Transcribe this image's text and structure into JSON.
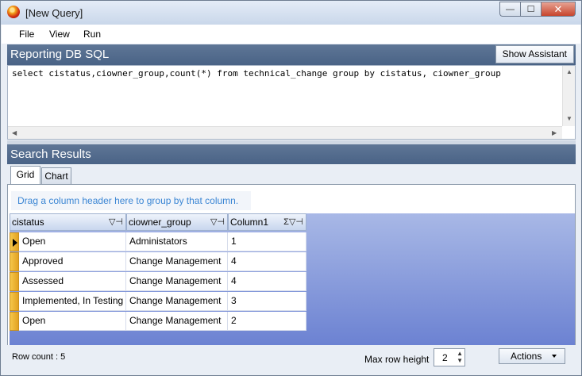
{
  "window": {
    "title": "[New Query]",
    "controls": {
      "minimize": "—",
      "maximize": "☐",
      "close": "✕"
    }
  },
  "menu": {
    "items": [
      {
        "label": "File"
      },
      {
        "label": "View"
      },
      {
        "label": "Run"
      }
    ]
  },
  "sql_panel": {
    "title": "Reporting DB SQL",
    "assistant_button": "Show Assistant",
    "query": "select cistatus,ciowner_group,count(*) from technical_change group by cistatus, ciowner_group"
  },
  "results": {
    "title": "Search Results",
    "tabs": [
      {
        "label": "Grid",
        "active": true
      },
      {
        "label": "Chart",
        "active": false
      }
    ],
    "group_hint": "Drag a column header here to group by that column.",
    "columns": [
      {
        "label": "cistatus"
      },
      {
        "label": "ciowner_group"
      },
      {
        "label": "Column1"
      }
    ],
    "rows": [
      {
        "cistatus": "Open",
        "ciowner_group": "Administators",
        "column1": "1"
      },
      {
        "cistatus": "Approved",
        "ciowner_group": "Change Management",
        "column1": "4"
      },
      {
        "cistatus": "Assessed",
        "ciowner_group": "Change Management",
        "column1": "4"
      },
      {
        "cistatus": "Implemented, In Testing",
        "ciowner_group": "Change Management",
        "column1": "3"
      },
      {
        "cistatus": "Open",
        "ciowner_group": "Change Management",
        "column1": "2"
      }
    ]
  },
  "status": {
    "row_count": "Row count : 5",
    "max_row_height_label": "Max row height",
    "max_row_height_value": "2",
    "actions_label": "Actions"
  },
  "icons": {
    "filter": "filter-icon",
    "pin": "pin-icon",
    "sum": "sum-icon",
    "current_row": "current-row-icon"
  }
}
